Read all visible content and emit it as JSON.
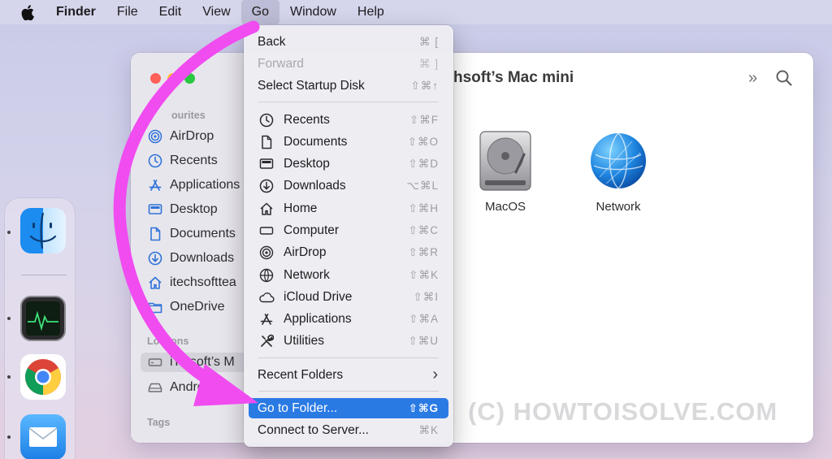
{
  "menubar": {
    "apple_icon": "apple-logo-icon",
    "app_name": "Finder",
    "items": [
      "File",
      "Edit",
      "View",
      "Go",
      "Window",
      "Help"
    ],
    "active_item": "Go"
  },
  "window": {
    "title": "hsoft’s Mac mini",
    "toolbar_more": "»",
    "search_icon": "magnifier-icon",
    "sidebar": {
      "favourites_header": "ourites",
      "favourites": [
        {
          "label": "AirDrop",
          "icon": "airdrop-icon"
        },
        {
          "label": "Recents",
          "icon": "clock-icon"
        },
        {
          "label": "Applications",
          "icon": "app-store-a-icon"
        },
        {
          "label": "Desktop",
          "icon": "desktop-icon"
        },
        {
          "label": "Documents",
          "icon": "document-icon"
        },
        {
          "label": "Downloads",
          "icon": "download-icon"
        },
        {
          "label": "itechsofttea",
          "icon": "home-icon"
        },
        {
          "label": "OneDrive",
          "icon": "folder-icon"
        }
      ],
      "locations_header": "Loc   ions",
      "locations": [
        {
          "label": "iTe   soft’s M",
          "icon": "computer-icon",
          "selected": true
        },
        {
          "label": "Andro",
          "icon": "drive-icon"
        }
      ],
      "tags_header": "Tags"
    },
    "content": [
      {
        "label": "MacOS",
        "icon": "hard-disk-icon"
      },
      {
        "label": "Network",
        "icon": "network-globe-icon"
      }
    ]
  },
  "go_menu": {
    "nav": [
      {
        "label": "Back",
        "shortcut": "⌘ [",
        "disabled": false
      },
      {
        "label": "Forward",
        "shortcut": "⌘ ]",
        "disabled": true
      },
      {
        "label": "Select Startup Disk",
        "shortcut": "⇧⌘↑",
        "disabled": false
      }
    ],
    "places": [
      {
        "label": "Recents",
        "shortcut": "⇧⌘F",
        "icon": "clock-icon"
      },
      {
        "label": "Documents",
        "shortcut": "⇧⌘O",
        "icon": "document-icon"
      },
      {
        "label": "Desktop",
        "shortcut": "⇧⌘D",
        "icon": "desktop-icon"
      },
      {
        "label": "Downloads",
        "shortcut": "⌥⌘L",
        "icon": "download-icon"
      },
      {
        "label": "Home",
        "shortcut": "⇧⌘H",
        "icon": "home-icon"
      },
      {
        "label": "Computer",
        "shortcut": "⇧⌘C",
        "icon": "computer-icon"
      },
      {
        "label": "AirDrop",
        "shortcut": "⇧⌘R",
        "icon": "airdrop-icon"
      },
      {
        "label": "Network",
        "shortcut": "⇧⌘K",
        "icon": "network-globe-icon"
      },
      {
        "label": "iCloud Drive",
        "shortcut": "⇧⌘I",
        "icon": "cloud-icon"
      },
      {
        "label": "Applications",
        "shortcut": "⇧⌘A",
        "icon": "app-store-a-icon"
      },
      {
        "label": "Utilities",
        "shortcut": "⇧⌘U",
        "icon": "tools-icon"
      }
    ],
    "recent_folders": {
      "label": "Recent Folders",
      "chevron": "›"
    },
    "go_to_folder": {
      "label": "Go to Folder...",
      "shortcut": "⇧⌘G",
      "highlighted": true
    },
    "connect": {
      "label": "Connect to Server...",
      "shortcut": "⌘K"
    }
  },
  "dock": {
    "apps": [
      {
        "name": "finder-icon"
      },
      {
        "name": "activity-monitor-icon"
      },
      {
        "name": "chrome-icon"
      },
      {
        "name": "mail-icon"
      }
    ]
  },
  "watermark": "(C) HOWTOISOLVE.COM",
  "colors": {
    "highlight": "#2a7ae4",
    "annotation_arrow": "#f04cf0",
    "close": "#fe5f57",
    "minimize": "#febc2e",
    "zoom": "#28c840"
  }
}
